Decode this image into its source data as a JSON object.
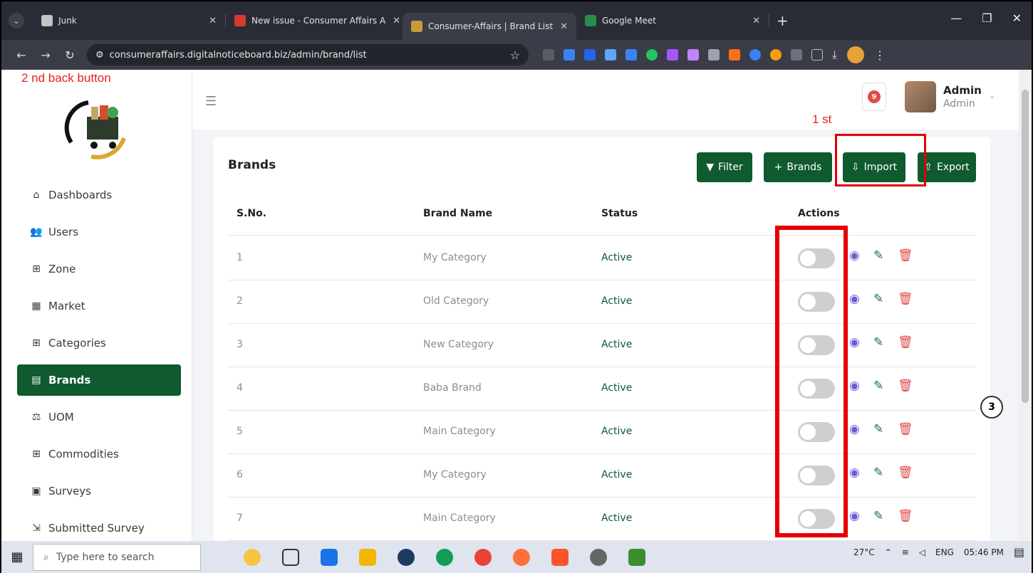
{
  "browser": {
    "tabs": [
      {
        "title": "Junk",
        "favicon_color": "#c4c4c4"
      },
      {
        "title": "New issue - Consumer Affairs A",
        "favicon_color": "#d63a2f"
      },
      {
        "title": "Consumer-Affairs | Brand List",
        "favicon_color": "#c79a3a",
        "active": true
      },
      {
        "title": "Google Meet",
        "favicon_color": "#2a8c4a"
      }
    ],
    "url": "consumeraffairs.digitalnoticeboard.biz/admin/brand/list"
  },
  "annotations": {
    "back_button_note": "2 nd back button",
    "first_note": "1 st",
    "badge": "3"
  },
  "sidebar": {
    "items": [
      {
        "label": "Dashboards",
        "icon": "home-icon",
        "glyph": "⌂"
      },
      {
        "label": "Users",
        "icon": "users-icon",
        "glyph": "👥"
      },
      {
        "label": "Zone",
        "icon": "grid-icon",
        "glyph": "⊞"
      },
      {
        "label": "Market",
        "icon": "store-icon",
        "glyph": "▦"
      },
      {
        "label": "Categories",
        "icon": "grid-icon",
        "glyph": "⊞"
      },
      {
        "label": "Brands",
        "icon": "clipboard-icon",
        "glyph": "▤",
        "active": true
      },
      {
        "label": "UOM",
        "icon": "scale-icon",
        "glyph": "⚖"
      },
      {
        "label": "Commodities",
        "icon": "grid-icon",
        "glyph": "⊞"
      },
      {
        "label": "Surveys",
        "icon": "form-icon",
        "glyph": "▣"
      },
      {
        "label": "Submitted Survey",
        "icon": "file-export-icon",
        "glyph": "⇲"
      }
    ]
  },
  "header": {
    "notification_count": "9",
    "user_name": "Admin",
    "user_role": "Admin"
  },
  "card": {
    "title": "Brands",
    "buttons": {
      "filter": "Filter",
      "add_brand": "Brands",
      "import": "Import",
      "export": "Export"
    },
    "columns": [
      "S.No.",
      "Brand Name",
      "Status",
      "Actions"
    ],
    "rows": [
      {
        "sno": "1",
        "name": "My Category",
        "status": "Active"
      },
      {
        "sno": "2",
        "name": "Old Category",
        "status": "Active"
      },
      {
        "sno": "3",
        "name": "New Category",
        "status": "Active"
      },
      {
        "sno": "4",
        "name": "Baba Brand",
        "status": "Active"
      },
      {
        "sno": "5",
        "name": "Main Category",
        "status": "Active"
      },
      {
        "sno": "6",
        "name": "My Category",
        "status": "Active"
      },
      {
        "sno": "7",
        "name": "Main Category",
        "status": "Active"
      }
    ]
  },
  "taskbar": {
    "search_placeholder": "Type here to search",
    "temperature": "27°C",
    "language": "ENG",
    "time": "05:46 PM"
  },
  "colors": {
    "primary_green": "#0f5a2f",
    "annotation_red": "#e40000",
    "view_icon": "#6a5cd6",
    "edit_icon": "#0f7a3a",
    "delete_icon": "#e14b4b"
  }
}
